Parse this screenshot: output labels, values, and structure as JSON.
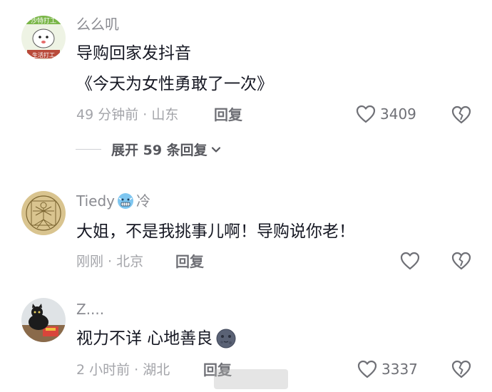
{
  "comments": [
    {
      "username": "么么叽",
      "lines": [
        "导购回家发抖音",
        "《今天为女性勇敢了一次》"
      ],
      "meta": "49 分钟前 · 山东",
      "reply_label": "回复",
      "likes": "3409",
      "avatar_text_top": "沙特打工",
      "avatar_text_bottom": "生活打工"
    },
    {
      "username": "Tiedy",
      "username_suffix": "冷",
      "lines": [
        "大姐，不是我挑事儿啊！导购说你老！"
      ],
      "meta": "刚刚 · 北京",
      "reply_label": "回复",
      "likes": ""
    },
    {
      "username": "Z....",
      "lines": [
        "视力不详 心地善良"
      ],
      "meta": "2 小时前 · 湖北",
      "reply_label": "回复",
      "likes": "3337"
    }
  ],
  "expand_replies": {
    "label": "展开 59 条回复"
  },
  "colors": {
    "text_primary": "#161823",
    "text_secondary": "#8a8b91",
    "meta": "#a3a4a9",
    "action": "#6f7076",
    "emoji_cold": "#7ec6f0"
  },
  "icons": [
    "heart-icon",
    "broken-heart-icon",
    "chevron-down-icon",
    "cold-face-emoji-icon",
    "moon-face-emoji-icon"
  ]
}
